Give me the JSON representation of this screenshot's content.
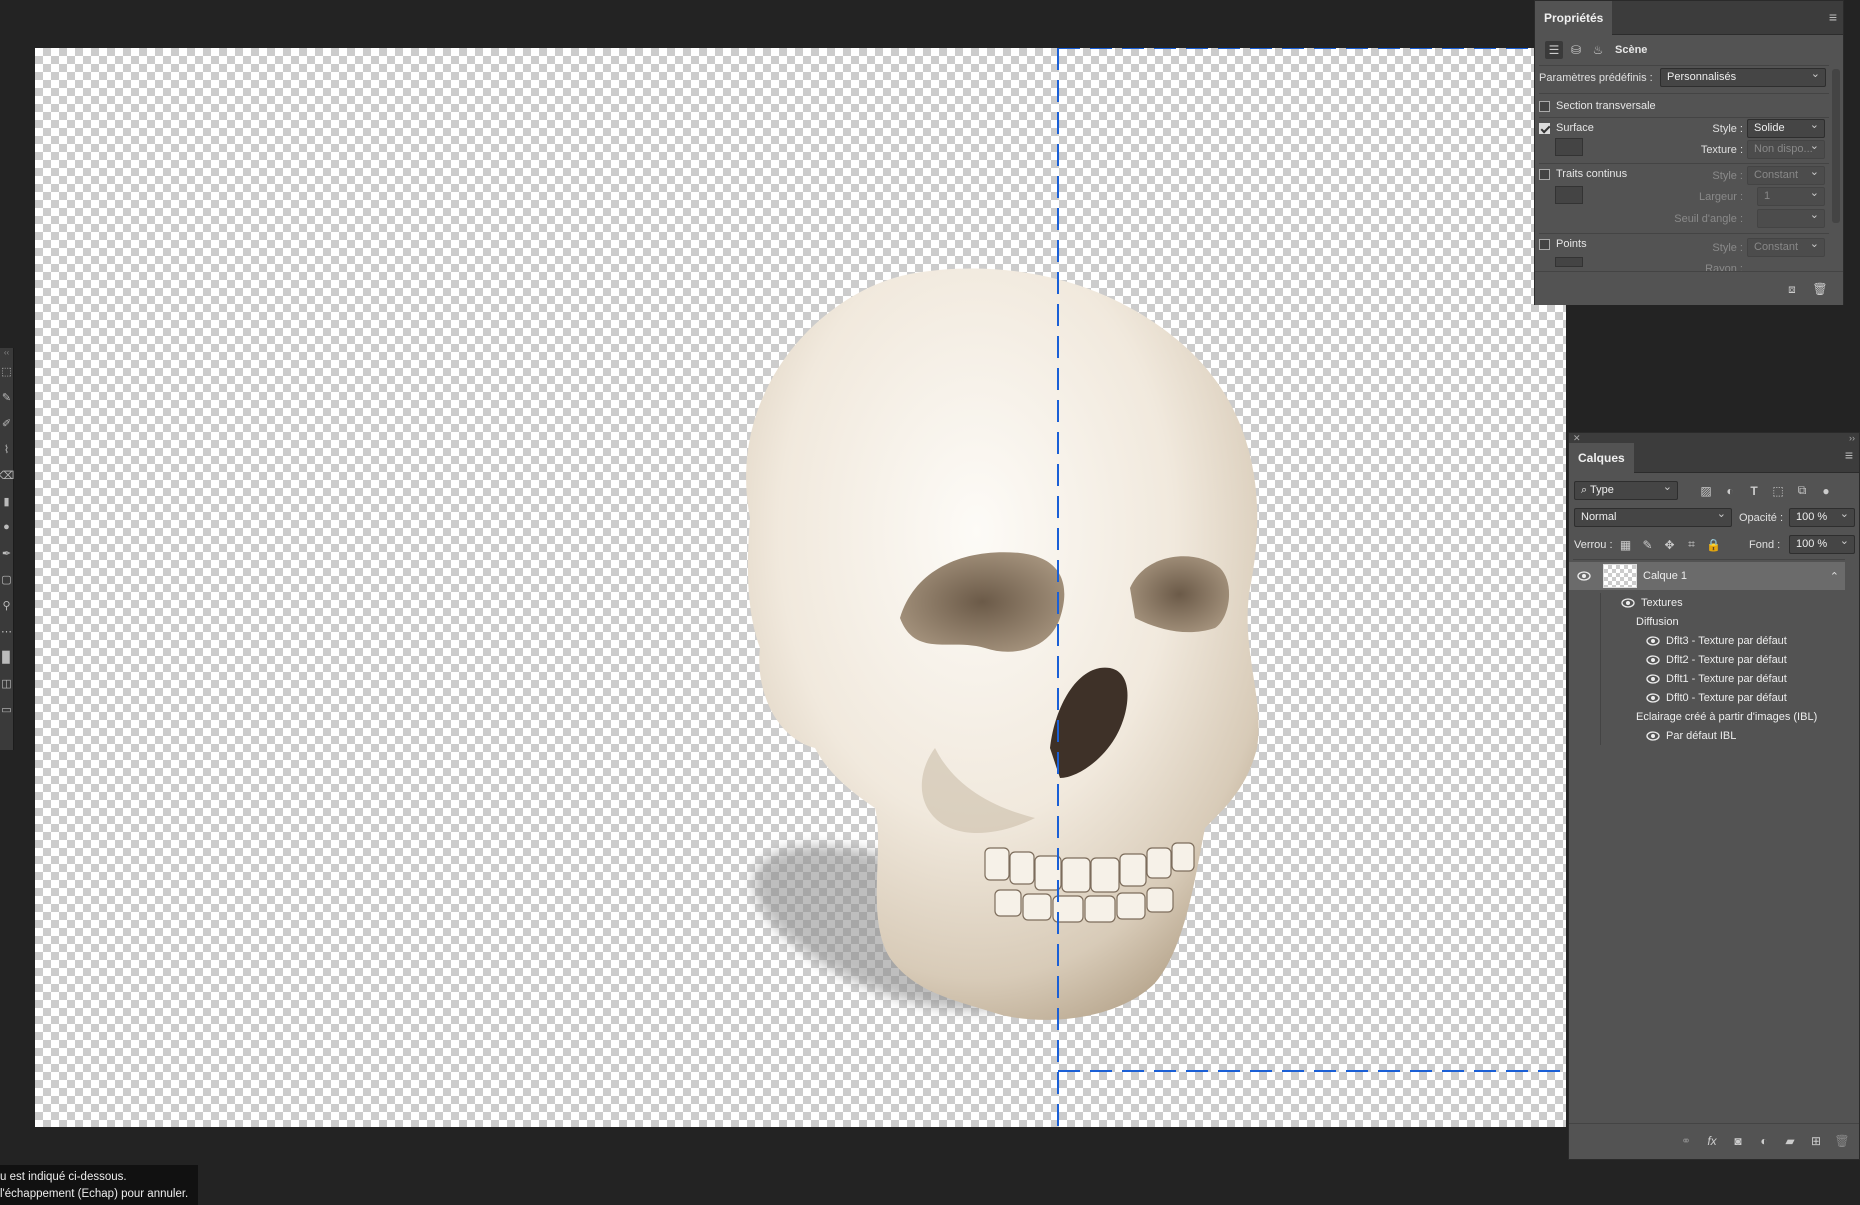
{
  "canvas": {
    "name": "skull-3d-model"
  },
  "properties_panel": {
    "title": "Propriétés",
    "mode_label": "Scène",
    "presets_label": "Paramètres prédéfinis :",
    "presets_value": "Personnalisés",
    "cross_section": {
      "label": "Section transversale",
      "checked": false
    },
    "surface": {
      "label": "Surface",
      "checked": true,
      "style_label": "Style :",
      "style_value": "Solide",
      "texture_label": "Texture :",
      "texture_value": "Non dispo..."
    },
    "lines": {
      "label": "Traits continus",
      "checked": false,
      "style_label": "Style :",
      "style_value": "Constant",
      "width_label": "Largeur :",
      "width_value": "1",
      "angle_label": "Seuil d'angle :",
      "angle_value": ""
    },
    "points": {
      "label": "Points",
      "checked": false,
      "style_label": "Style :",
      "style_value": "Constant",
      "radius_label": "Rayon :"
    }
  },
  "layers_panel": {
    "title": "Calques",
    "filter_value": "Type",
    "blend_mode": "Normal",
    "opacity_label": "Opacité :",
    "opacity_value": "100 %",
    "lock_label": "Verrou :",
    "fill_label": "Fond :",
    "fill_value": "100 %",
    "layer_name": "Calque 1",
    "items": {
      "textures": "Textures",
      "diffusion": "Diffusion",
      "t3": "Dflt3 - Texture par défaut",
      "t2": "Dflt2 - Texture par défaut",
      "t1": "Dflt1 - Texture par défaut",
      "t0": "Dflt0 - Texture par défaut",
      "ibl": "Eclairage créé à partir d'images (IBL)",
      "ibl_default": "Par défaut IBL"
    }
  },
  "status": {
    "line1": "u est indiqué ci-dessous.",
    "line2": "l'échappement (Echap) pour annuler."
  },
  "colors": {
    "guide": "#1a5fd6",
    "panel": "#535353",
    "app_bg": "#232323"
  }
}
